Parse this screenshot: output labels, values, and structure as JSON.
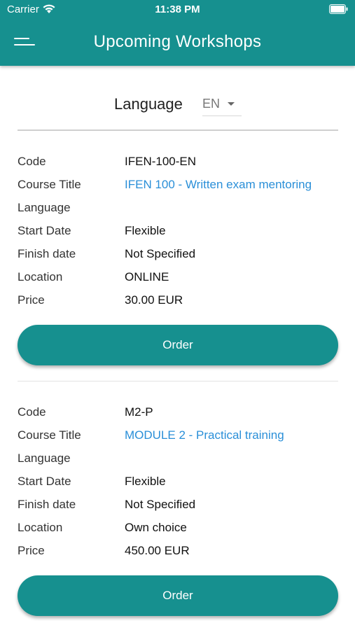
{
  "status": {
    "carrier": "Carrier",
    "time": "11:38 PM"
  },
  "header": {
    "title": "Upcoming Workshops",
    "menu_icon": "hamburger-menu-icon"
  },
  "language": {
    "label": "Language",
    "selected": "EN"
  },
  "field_labels": {
    "code": "Code",
    "course_title": "Course Title",
    "language": "Language",
    "start_date": "Start Date",
    "finish_date": "Finish date",
    "location": "Location",
    "price": "Price"
  },
  "courses": [
    {
      "code": "IFEN-100-EN",
      "course_title": "IFEN 100 - Written exam mentoring",
      "language": "",
      "start_date": "Flexible",
      "finish_date": "Not Specified",
      "location": "ONLINE",
      "price": "30.00 EUR",
      "order_label": "Order"
    },
    {
      "code": "M2-P",
      "course_title": "MODULE 2 - Practical training",
      "language": "",
      "start_date": "Flexible",
      "finish_date": "Not Specified",
      "location": "Own choice",
      "price": "450.00 EUR",
      "order_label": "Order"
    }
  ],
  "colors": {
    "accent": "#16908f",
    "link": "#2a8fd8"
  }
}
